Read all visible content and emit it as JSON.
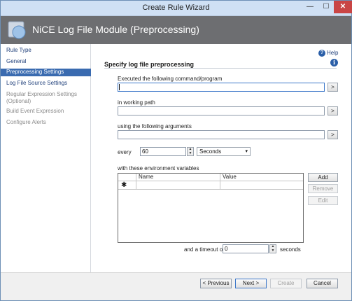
{
  "window": {
    "title": "Create Rule Wizard",
    "minimize": "—",
    "maximize": "☐",
    "close": "✕"
  },
  "banner": {
    "title": "NiCE Log File Module (Preprocessing)"
  },
  "nav": {
    "items": [
      {
        "label": "Rule Type",
        "state": "link"
      },
      {
        "label": "General",
        "state": "link"
      },
      {
        "label": "Preprocessing Settings",
        "state": "active"
      },
      {
        "label": "Log File Source Settings",
        "state": "link"
      },
      {
        "label": "Regular Expression Settings (Optional)",
        "state": "dim"
      },
      {
        "label": "Build Event Expression",
        "state": "dim"
      },
      {
        "label": "Configure Alerts",
        "state": "dim"
      }
    ]
  },
  "help": {
    "label": "Help",
    "icon": "?",
    "info_icon": "i"
  },
  "form": {
    "section_title": "Specify log file preprocessing",
    "command_label": "Executed the following command/program",
    "command_value": "",
    "working_path_label": "in working path",
    "working_path_value": "",
    "arguments_label": "using the following arguments",
    "arguments_value": "",
    "browse_label": ">",
    "every_label": "every",
    "every_value": "60",
    "unit_value": "Seconds",
    "env_label": "with these environment variables",
    "grid": {
      "columns": [
        "Name",
        "Value"
      ],
      "new_row_marker": "✱"
    },
    "add_label": "Add",
    "remove_label": "Remove",
    "edit_label": "Edit",
    "timeout_label": "and a timeout of",
    "timeout_value": "0",
    "timeout_unit": "seconds",
    "spin_up": "▲",
    "spin_down": "▼",
    "chevron": "▾"
  },
  "footer": {
    "previous": "< Previous",
    "next": "Next >",
    "create": "Create",
    "cancel": "Cancel"
  }
}
